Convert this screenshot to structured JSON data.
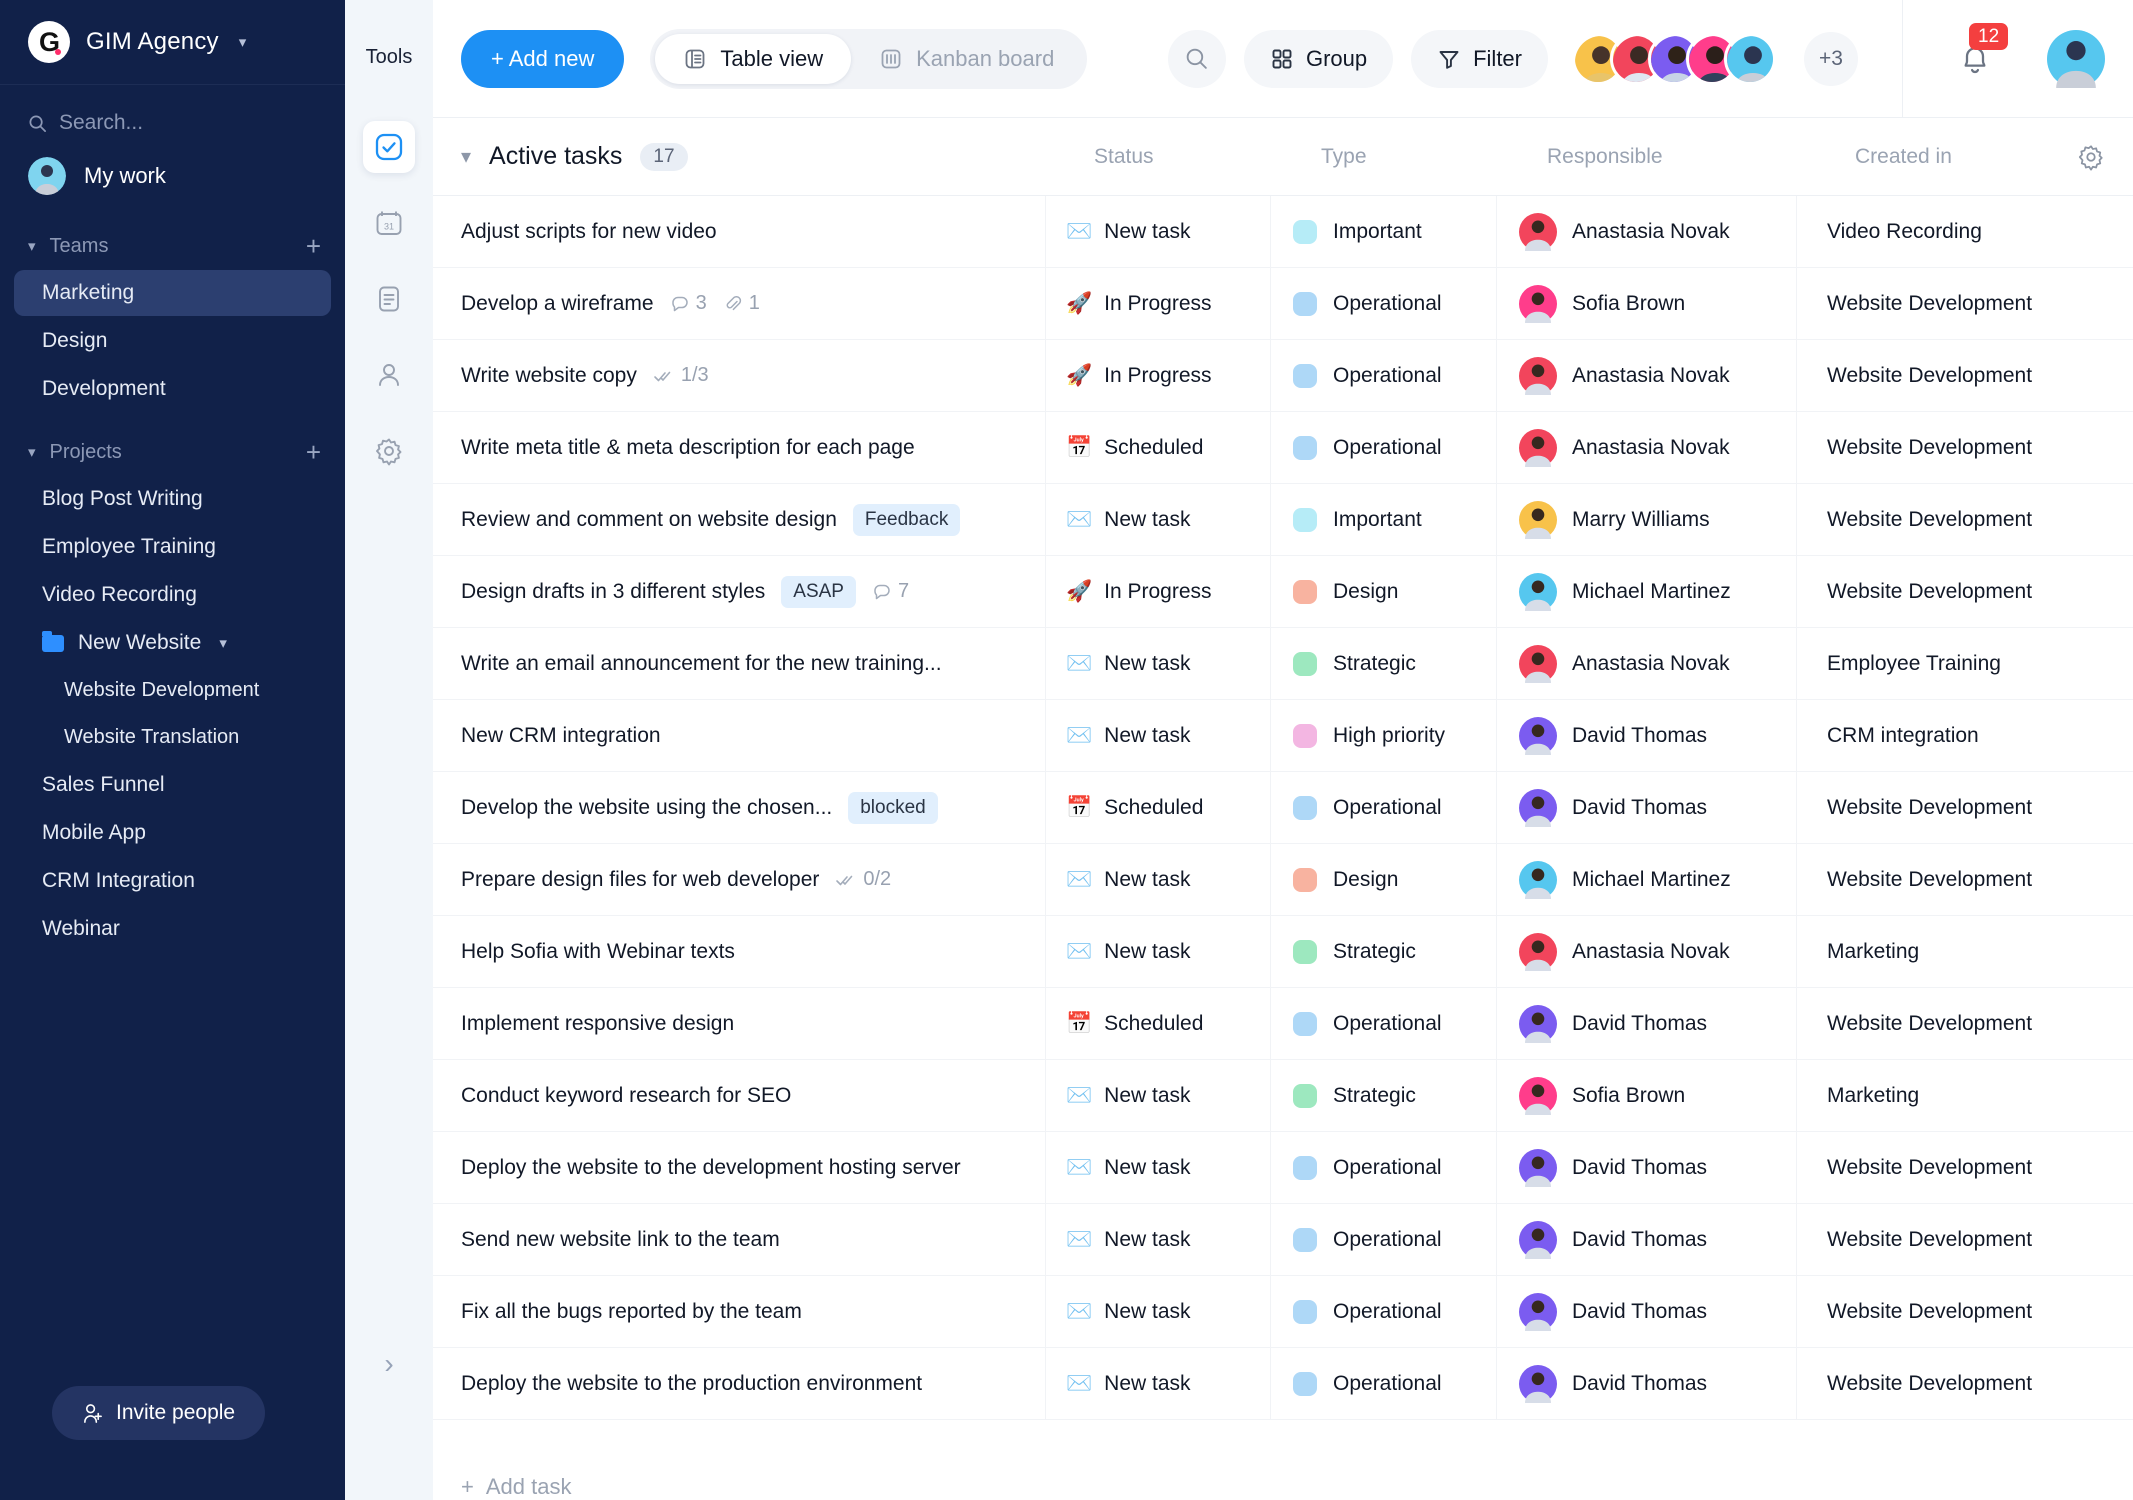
{
  "sidebar": {
    "brand": {
      "name": "GIM Agency",
      "logo_letter": "G",
      "caret_icon": "chevron-down-icon"
    },
    "search": {
      "placeholder": "Search...",
      "icon": "search-icon"
    },
    "my_work": {
      "label": "My work",
      "avatar_color": "#7fd4ef"
    },
    "teams": {
      "title": "Teams",
      "add_label": "+",
      "items": [
        {
          "label": "Marketing",
          "active": true
        },
        {
          "label": "Design",
          "active": false
        },
        {
          "label": "Development",
          "active": false
        }
      ]
    },
    "projects": {
      "title": "Projects",
      "add_label": "+",
      "items": [
        {
          "label": "Blog Post Writing",
          "type": "item"
        },
        {
          "label": "Employee Training",
          "type": "item"
        },
        {
          "label": "Video Recording",
          "type": "item"
        },
        {
          "label": "New Website",
          "type": "folder"
        },
        {
          "label": "Website Development",
          "type": "sub"
        },
        {
          "label": "Website Translation",
          "type": "sub"
        },
        {
          "label": "Sales Funnel",
          "type": "item"
        },
        {
          "label": "Mobile App",
          "type": "item"
        },
        {
          "label": "CRM Integration",
          "type": "item"
        },
        {
          "label": "Webinar",
          "type": "item"
        }
      ]
    },
    "invite": {
      "label": "Invite people",
      "icon": "add-person-icon"
    },
    "accent": "#2e8fff",
    "bg": "#112149"
  },
  "tools": {
    "title": "Tools",
    "items": [
      {
        "icon": "tasks-check-icon",
        "active": true
      },
      {
        "icon": "calendar-31-icon",
        "active": false
      },
      {
        "icon": "document-icon",
        "active": false
      },
      {
        "icon": "person-icon",
        "active": false
      },
      {
        "icon": "gear-icon",
        "active": false
      }
    ],
    "expand_icon": "chevron-right-icon"
  },
  "toolbar": {
    "add_new_label": "+ Add new",
    "views": [
      {
        "label": "Table view",
        "icon": "table-icon",
        "active": true
      },
      {
        "label": "Kanban board",
        "icon": "kanban-icon",
        "active": false
      }
    ],
    "search_icon": "search-icon",
    "group_label": "Group",
    "group_icon": "grid-icon",
    "filter_label": "Filter",
    "filter_icon": "funnel-icon",
    "members_overflow": "+3",
    "member_avatars": [
      "#f8c24a",
      "#f2455c",
      "#7b5cf0",
      "#ff3d8b",
      "#56c7ef"
    ],
    "notifications_count": "12",
    "bell_icon": "bell-icon",
    "account_avatar_color": "#56c7ef",
    "accent": "#1d90f4",
    "badge_color": "#f43f3f"
  },
  "table": {
    "group_title": "Active tasks",
    "group_count": "17",
    "settings_icon": "gear-icon",
    "columns": [
      "Status",
      "Type",
      "Responsible",
      "Created in"
    ],
    "add_task_label": "Add task",
    "rows": [
      {
        "task": "Adjust scripts for new video",
        "tag": "",
        "meta": [],
        "status": "New task",
        "status_icon": "envelope",
        "type": "Important",
        "type_color": "#b6ecf7",
        "responsible": "Anastasia Novak",
        "avatar_color": "#f2455c",
        "created_in": "Video Recording"
      },
      {
        "task": "Develop a wireframe",
        "tag": "",
        "meta": [
          {
            "icon": "comment-icon",
            "value": "3"
          },
          {
            "icon": "attachment-icon",
            "value": "1"
          }
        ],
        "status": "In Progress",
        "status_icon": "rocket",
        "type": "Operational",
        "type_color": "#aed8f7",
        "responsible": "Sofia Brown",
        "avatar_color": "#ff3d8b",
        "created_in": "Website Development"
      },
      {
        "task": "Write website copy",
        "tag": "",
        "meta": [
          {
            "icon": "double-check-icon",
            "value": "1/3"
          }
        ],
        "status": "In Progress",
        "status_icon": "rocket",
        "type": "Operational",
        "type_color": "#aed8f7",
        "responsible": "Anastasia Novak",
        "avatar_color": "#f2455c",
        "created_in": "Website Development"
      },
      {
        "task": "Write meta title & meta description for each page",
        "tag": "",
        "meta": [],
        "status": "Scheduled",
        "status_icon": "calendar",
        "type": "Operational",
        "type_color": "#aed8f7",
        "responsible": "Anastasia Novak",
        "avatar_color": "#f2455c",
        "created_in": "Website Development"
      },
      {
        "task": "Review and comment on website design",
        "tag": "Feedback",
        "meta": [],
        "status": "New task",
        "status_icon": "envelope",
        "type": "Important",
        "type_color": "#b6ecf7",
        "responsible": "Marry Williams",
        "avatar_color": "#f8c24a",
        "created_in": "Website Development"
      },
      {
        "task": "Design drafts in 3 different styles",
        "tag": "ASAP",
        "meta": [
          {
            "icon": "comment-icon",
            "value": "7"
          }
        ],
        "status": "In Progress",
        "status_icon": "rocket",
        "type": "Design",
        "type_color": "#f8b3a0",
        "responsible": "Michael Martinez",
        "avatar_color": "#56c7ef",
        "created_in": "Website Development"
      },
      {
        "task": "Write an email announcement for the new training...",
        "tag": "",
        "meta": [],
        "status": "New task",
        "status_icon": "envelope",
        "type": "Strategic",
        "type_color": "#9de8bf",
        "responsible": "Anastasia Novak",
        "avatar_color": "#f2455c",
        "created_in": "Employee Training"
      },
      {
        "task": "New CRM integration",
        "tag": "",
        "meta": [],
        "status": "New task",
        "status_icon": "envelope",
        "type": "High priority",
        "type_color": "#f3b6e2",
        "responsible": "David Thomas",
        "avatar_color": "#7b5cf0",
        "created_in": "CRM integration"
      },
      {
        "task": "Develop the website using the chosen...",
        "tag": "blocked",
        "meta": [],
        "status": "Scheduled",
        "status_icon": "calendar",
        "type": "Operational",
        "type_color": "#aed8f7",
        "responsible": "David Thomas",
        "avatar_color": "#7b5cf0",
        "created_in": "Website Development"
      },
      {
        "task": "Prepare design files for web developer",
        "tag": "",
        "meta": [
          {
            "icon": "double-check-icon",
            "value": "0/2"
          }
        ],
        "status": "New task",
        "status_icon": "envelope",
        "type": "Design",
        "type_color": "#f8b3a0",
        "responsible": "Michael Martinez",
        "avatar_color": "#56c7ef",
        "created_in": "Website Development"
      },
      {
        "task": "Help Sofia with Webinar texts",
        "tag": "",
        "meta": [],
        "status": "New task",
        "status_icon": "envelope",
        "type": "Strategic",
        "type_color": "#9de8bf",
        "responsible": "Anastasia Novak",
        "avatar_color": "#f2455c",
        "created_in": "Marketing"
      },
      {
        "task": "Implement responsive design",
        "tag": "",
        "meta": [],
        "status": "Scheduled",
        "status_icon": "calendar",
        "type": "Operational",
        "type_color": "#aed8f7",
        "responsible": "David Thomas",
        "avatar_color": "#7b5cf0",
        "created_in": "Website Development"
      },
      {
        "task": "Conduct keyword research for SEO",
        "tag": "",
        "meta": [],
        "status": "New task",
        "status_icon": "envelope",
        "type": "Strategic",
        "type_color": "#9de8bf",
        "responsible": "Sofia Brown",
        "avatar_color": "#ff3d8b",
        "created_in": "Marketing"
      },
      {
        "task": "Deploy the website to the development hosting server",
        "tag": "",
        "meta": [],
        "status": "New task",
        "status_icon": "envelope",
        "type": "Operational",
        "type_color": "#aed8f7",
        "responsible": "David Thomas",
        "avatar_color": "#7b5cf0",
        "created_in": "Website Development"
      },
      {
        "task": "Send new website link to the team",
        "tag": "",
        "meta": [],
        "status": "New task",
        "status_icon": "envelope",
        "type": "Operational",
        "type_color": "#aed8f7",
        "responsible": "David Thomas",
        "avatar_color": "#7b5cf0",
        "created_in": "Website Development"
      },
      {
        "task": "Fix all the bugs reported by the team",
        "tag": "",
        "meta": [],
        "status": "New task",
        "status_icon": "envelope",
        "type": "Operational",
        "type_color": "#aed8f7",
        "responsible": "David Thomas",
        "avatar_color": "#7b5cf0",
        "created_in": "Website Development"
      },
      {
        "task": "Deploy the website to the production environment",
        "tag": "",
        "meta": [],
        "status": "New task",
        "status_icon": "envelope",
        "type": "Operational",
        "type_color": "#aed8f7",
        "responsible": "David Thomas",
        "avatar_color": "#7b5cf0",
        "created_in": "Website Development"
      }
    ]
  }
}
